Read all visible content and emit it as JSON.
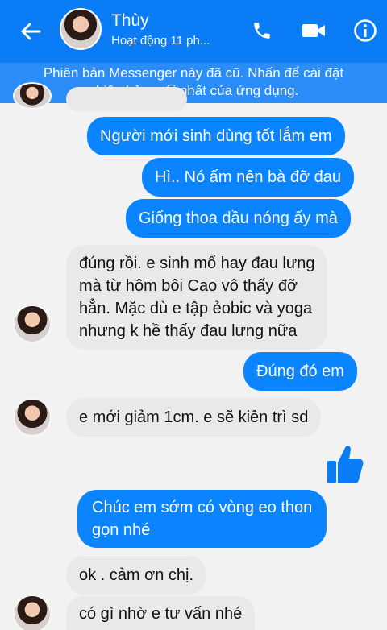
{
  "header": {
    "contact_name": "Thùy",
    "status": "Hoạt động 11 ph...",
    "back_icon": "arrow-left-icon",
    "call_icon": "phone-icon",
    "video_icon": "video-camera-icon",
    "info_icon": "info-icon",
    "color": "#0a7cf5"
  },
  "banner": {
    "line1": "Phiên bản Messenger này đã cũ. Nhấn để cài đặt",
    "line2": "phiên bản mới nhất của ứng dụng."
  },
  "messages": [
    {
      "sender": "me",
      "lines": [
        "Người mới sinh dùng tốt lắm em"
      ]
    },
    {
      "sender": "me",
      "lines": [
        "Hì.. Nó ấm nên bà đỡ đau"
      ]
    },
    {
      "sender": "me",
      "lines": [
        "Giống thoa dầu nóng ấy mà"
      ]
    },
    {
      "sender": "contact",
      "lines": [
        "đúng rồi. e sinh mổ hay đau lưng",
        "mà từ hôm bôi Cao vô thấy đỡ",
        "hẳn. Mặc dù e tập ẻobic và yoga",
        "nhưng k hề thấy đau lưng nữa"
      ]
    },
    {
      "sender": "me",
      "lines": [
        "Đúng đó em"
      ]
    },
    {
      "sender": "contact",
      "lines": [
        "e mới giảm 1cm. e sẽ kiên trì sd"
      ]
    },
    {
      "sender": "contact",
      "sticker": "thumbs-up-icon"
    },
    {
      "sender": "me",
      "lines": [
        "Chúc em sớm có vòng eo thon",
        "gọn nhé"
      ]
    },
    {
      "sender": "contact",
      "lines": [
        "ok . cảm ơn chị."
      ]
    },
    {
      "sender": "contact",
      "lines": [
        "có gì nhờ e tư vấn nhé"
      ]
    }
  ],
  "colors": {
    "outgoing_bubble": "#0a84ff",
    "incoming_bubble": "#e9e9ea",
    "background": "#f2f2f2"
  }
}
